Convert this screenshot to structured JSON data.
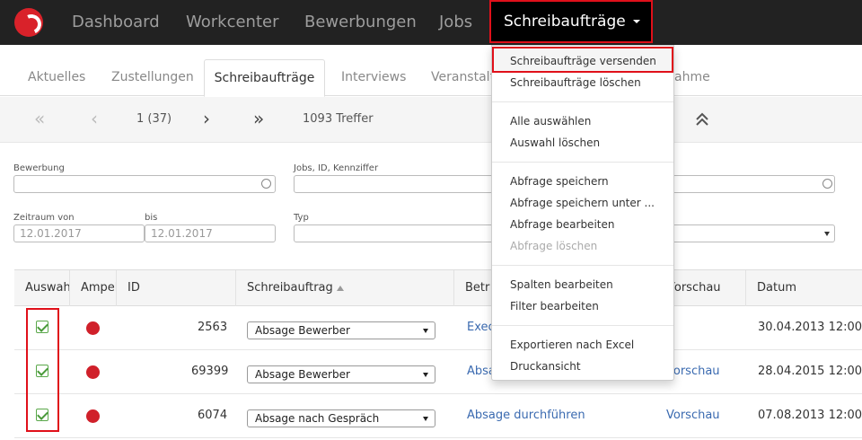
{
  "navbar": {
    "items": [
      "Dashboard",
      "Workcenter",
      "Bewerbungen",
      "Jobs"
    ],
    "active": "Schreibaufträge"
  },
  "tabs": {
    "items": [
      "Aktuelles",
      "Zustellungen",
      "Interviews",
      "Veranstalt",
      "ahme"
    ],
    "active": "Schreibaufträge"
  },
  "pager": {
    "page": "1 (37)",
    "hits": "1093 Treffer"
  },
  "filters": {
    "bewerbung_label": "Bewerbung",
    "jobs_label": "Jobs, ID, Kennziffer",
    "zeitraum_label": "Zeitraum von",
    "bis_label": "bis",
    "date_from": "12.01.2017",
    "date_to": "12.01.2017",
    "typ_label": "Typ"
  },
  "table": {
    "headers": [
      "Auswah",
      "Ampel",
      "ID",
      "Schreibauftrag",
      "Betr",
      "Vorschau",
      "Datum"
    ],
    "rows": [
      {
        "id": "2563",
        "auftrag": "Absage Bewerber",
        "betr": "Exec",
        "vorschau": "",
        "datum": "30.04.2013 12:00"
      },
      {
        "id": "69399",
        "auftrag": "Absage Bewerber",
        "betr": "Absa",
        "vorschau": "Vorschau",
        "datum": "28.04.2015 12:00"
      },
      {
        "id": "6074",
        "auftrag": "Absage nach Gespräch",
        "betr": "Absage durchführen",
        "vorschau": "Vorschau",
        "datum": "07.08.2013 12:00"
      }
    ]
  },
  "dropdown": {
    "items": [
      "Schreibaufträge versenden",
      "Schreibaufträge löschen",
      "Alle auswählen",
      "Auswahl löschen",
      "Abfrage speichern",
      "Abfrage speichern unter ...",
      "Abfrage bearbeiten",
      "Abfrage löschen",
      "Spalten bearbeiten",
      "Filter bearbeiten",
      "Exportieren nach Excel",
      "Druckansicht"
    ]
  },
  "colors": {
    "highlight": "#e0101a",
    "status_red": "#d0202a",
    "check_green": "#4a9a3a",
    "link": "#3a6ab0"
  }
}
